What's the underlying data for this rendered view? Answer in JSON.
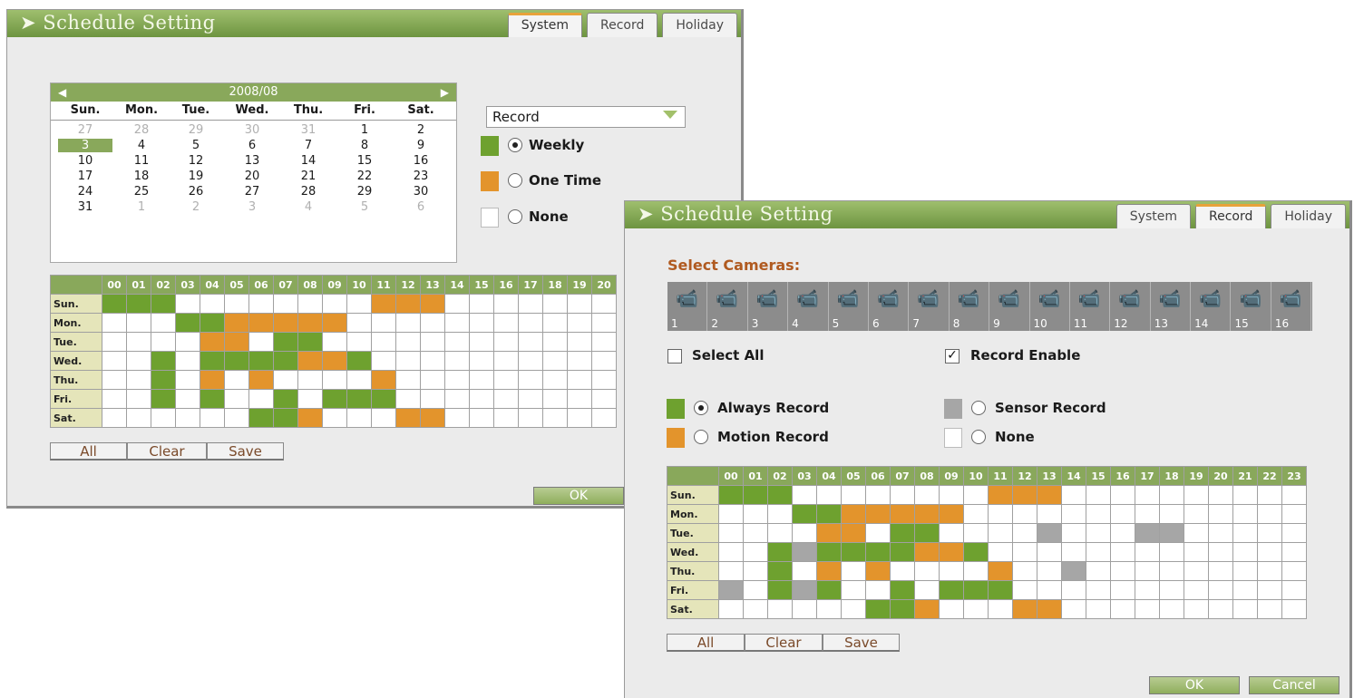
{
  "window1": {
    "title": "➤ Schedule Setting",
    "tabs": [
      "System",
      "Record",
      "Holiday"
    ],
    "active_tab": "System",
    "calendar": {
      "month": "2008/08",
      "days_of_week": [
        "Sun.",
        "Mon.",
        "Tue.",
        "Wed.",
        "Thu.",
        "Fri.",
        "Sat."
      ],
      "weeks": [
        [
          "27",
          "28",
          "29",
          "30",
          "31",
          "1",
          "2"
        ],
        [
          "3",
          "4",
          "5",
          "6",
          "7",
          "8",
          "9"
        ],
        [
          "10",
          "11",
          "12",
          "13",
          "14",
          "15",
          "16"
        ],
        [
          "17",
          "18",
          "19",
          "20",
          "21",
          "22",
          "23"
        ],
        [
          "24",
          "25",
          "26",
          "27",
          "28",
          "29",
          "30"
        ],
        [
          "31",
          "1",
          "2",
          "3",
          "4",
          "5",
          "6"
        ]
      ],
      "selected_day": "3"
    },
    "dropdown_value": "Record",
    "options": [
      {
        "label": "Weekly",
        "color": "#6ea12f",
        "selected": true
      },
      {
        "label": "One Time",
        "color": "#e3942c",
        "selected": false
      },
      {
        "label": "None",
        "color": "#ffffff",
        "selected": false
      }
    ],
    "schedule": {
      "hours": [
        "00",
        "01",
        "02",
        "03",
        "04",
        "05",
        "06",
        "07",
        "08",
        "09",
        "10",
        "11",
        "12",
        "13",
        "14",
        "15",
        "16",
        "17",
        "18",
        "19",
        "20"
      ],
      "rows": [
        {
          "day": "Sun.",
          "cells": "gggwwwwwwwwooowwwwwww"
        },
        {
          "day": "Mon.",
          "cells": "wwwggooooowwwwwwwwwww"
        },
        {
          "day": "Tue.",
          "cells": "wwwwoowggwwwwwwwwwwww"
        },
        {
          "day": "Wed.",
          "cells": "wwgwggggoogwwwwwwwwww"
        },
        {
          "day": "Thu.",
          "cells": "wwgwowowwwwowwwwwwwww"
        },
        {
          "day": "Fri.",
          "cells": "wwgwgwwgwgggwwwwwwwww"
        },
        {
          "day": "Sat.",
          "cells": "wwwwwwggowwwoowwwwwww"
        }
      ]
    },
    "buttons": {
      "all": "All",
      "clear": "Clear",
      "save": "Save",
      "ok": "OK"
    }
  },
  "window2": {
    "title": "➤ Schedule Setting",
    "tabs": [
      "System",
      "Record",
      "Holiday"
    ],
    "active_tab": "Record",
    "select_cameras_label": "Select Cameras:",
    "cameras": [
      "1",
      "2",
      "3",
      "4",
      "5",
      "6",
      "7",
      "8",
      "9",
      "10",
      "11",
      "12",
      "13",
      "14",
      "15",
      "16"
    ],
    "select_all": {
      "label": "Select All",
      "checked": false
    },
    "record_enable": {
      "label": "Record Enable",
      "checked": true
    },
    "options": [
      {
        "label": "Always Record",
        "color": "#6ea12f",
        "selected": true
      },
      {
        "label": "Motion Record",
        "color": "#e3942c",
        "selected": false
      },
      {
        "label": "Sensor Record",
        "color": "#a6a6a6",
        "selected": false
      },
      {
        "label": "None",
        "color": "#ffffff",
        "selected": false
      }
    ],
    "schedule": {
      "hours": [
        "00",
        "01",
        "02",
        "03",
        "04",
        "05",
        "06",
        "07",
        "08",
        "09",
        "10",
        "11",
        "12",
        "13",
        "14",
        "15",
        "16",
        "17",
        "18",
        "19",
        "20",
        "21",
        "22",
        "23"
      ],
      "rows": [
        {
          "day": "Sun.",
          "cells": "gggwwwwwwwwooowwwwwwwwww"
        },
        {
          "day": "Mon.",
          "cells": "wwwggooooowwwwwwwwwwwwww"
        },
        {
          "day": "Tue.",
          "cells": "wwwwoowggwwwwswwwsswwwww"
        },
        {
          "day": "Wed.",
          "cells": "wwgsggggoogwwwwwwwwwwwww"
        },
        {
          "day": "Thu.",
          "cells": "wwgwowowwwwowwswwwwwwwww"
        },
        {
          "day": "Fri.",
          "cells": "swgsgwwgwgggwwwwwwwwwwww"
        },
        {
          "day": "Sat.",
          "cells": "wwwwwwggowwwoowwwwwwwwww"
        }
      ]
    },
    "buttons": {
      "all": "All",
      "clear": "Clear",
      "save": "Save",
      "ok": "OK",
      "cancel": "Cancel"
    }
  }
}
